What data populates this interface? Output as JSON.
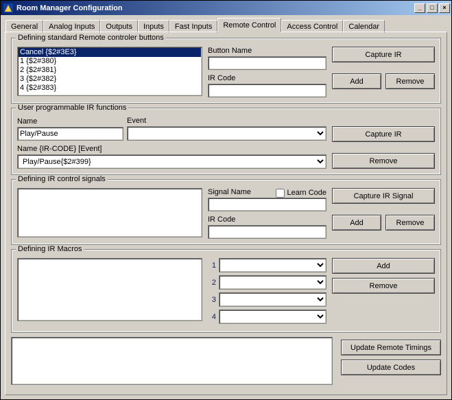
{
  "window": {
    "title": "Room Manager Configuration",
    "min": "_",
    "max": "□",
    "close": "×"
  },
  "tabs": {
    "t0": "General",
    "t1": "Analog Inputs",
    "t2": "Outputs",
    "t3": "Inputs",
    "t4": "Fast Inputs",
    "t5": "Remote Control",
    "t6": "Access Control",
    "t7": "Calendar"
  },
  "std": {
    "title": "Defining standard Remote controler buttons",
    "items": {
      "i0": "Cancel {$2#3E3}",
      "i1": "1 {$2#380}",
      "i2": "2 {$2#381}",
      "i3": "3 {$2#382}",
      "i4": "4 {$2#383}"
    },
    "buttonName_lbl": "Button Name",
    "buttonName_val": "",
    "irCode_lbl": "IR Code",
    "irCode_val": "",
    "capture": "Capture IR",
    "add": "Add",
    "remove": "Remove"
  },
  "user": {
    "title": "User programmable IR functions",
    "name_lbl": "Name",
    "name_val": "Play/Pause",
    "event_lbl": "Event",
    "event_val": "",
    "combo_lbl": "Name  {IR-CODE} [Event]",
    "combo_val": "Play/Pause{$2#399}",
    "capture": "Capture IR",
    "remove": "Remove"
  },
  "sig": {
    "title": "Defining IR control signals",
    "signalName_lbl": "Signal Name",
    "signalName_val": "",
    "learn_lbl": "Learn Code",
    "irCode_lbl": "IR Code",
    "irCode_val": "",
    "capture": "Capture IR Signal",
    "add": "Add",
    "remove": "Remove"
  },
  "macro": {
    "title": "Defining IR Macros",
    "n1": "1",
    "n2": "2",
    "n3": "3",
    "n4": "4",
    "add": "Add",
    "remove": "Remove"
  },
  "bottom": {
    "updTimings": "Update Remote Timings",
    "updCodes": "Update Codes"
  }
}
